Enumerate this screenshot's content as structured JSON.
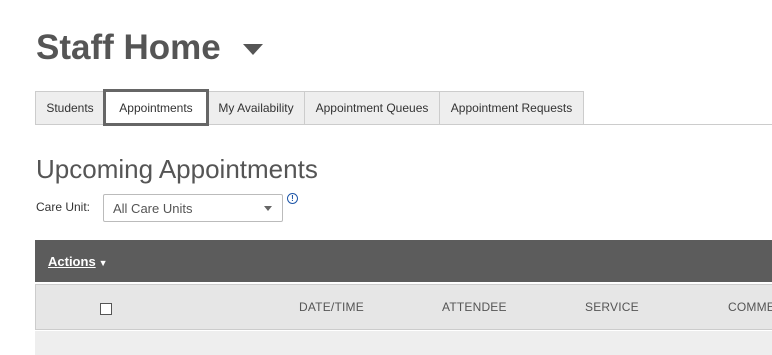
{
  "page": {
    "title": "Staff Home"
  },
  "tabs": [
    {
      "label": "Students"
    },
    {
      "label": "Appointments"
    },
    {
      "label": "My Availability"
    },
    {
      "label": "Appointment Queues"
    },
    {
      "label": "Appointment Requests"
    }
  ],
  "active_tab": "Appointments",
  "section": {
    "title": "Upcoming Appointments"
  },
  "care_unit": {
    "label": "Care Unit:",
    "selected": "All Care Units",
    "info_icon": "info-circle-icon"
  },
  "actions": {
    "label": "Actions"
  },
  "table": {
    "columns": [
      "DATE/TIME",
      "ATTENDEE",
      "SERVICE",
      "COMME"
    ]
  },
  "colors": {
    "accent": "#1f57a8",
    "actions_bar": "#5c5c5c",
    "header_bg": "#e6e6e6",
    "tab_bg": "#eeeeee"
  }
}
